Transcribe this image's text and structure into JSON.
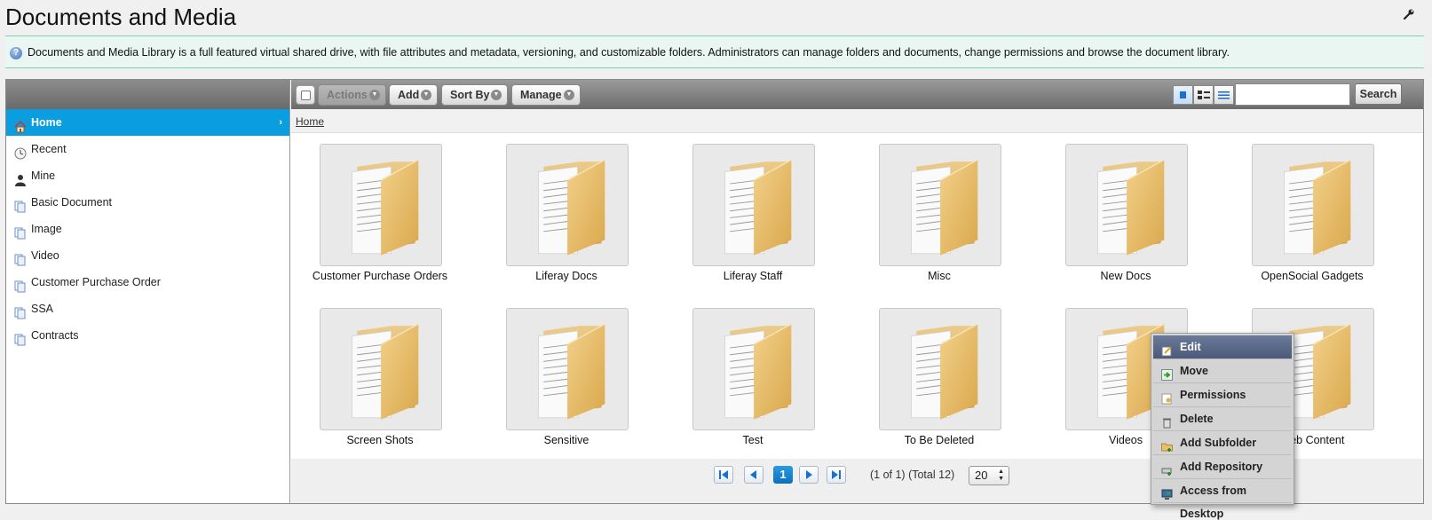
{
  "page": {
    "title": "Documents and Media",
    "description": "Documents and Media Library is a full featured virtual shared drive, with file attributes and metadata, versioning, and customizable folders. Administrators can manage folders and documents, change permissions and browse the document library."
  },
  "sidebar": {
    "items": [
      {
        "label": "Home",
        "icon": "home-icon",
        "active": true
      },
      {
        "label": "Recent",
        "icon": "clock-icon"
      },
      {
        "label": "Mine",
        "icon": "user-icon"
      },
      {
        "label": "Basic Document",
        "icon": "document-type-icon"
      },
      {
        "label": "Image",
        "icon": "document-type-icon"
      },
      {
        "label": "Video",
        "icon": "document-type-icon"
      },
      {
        "label": "Customer Purchase Order",
        "icon": "document-type-icon"
      },
      {
        "label": "SSA",
        "icon": "document-type-icon"
      },
      {
        "label": "Contracts",
        "icon": "document-type-icon"
      }
    ]
  },
  "toolbar": {
    "actions_label": "Actions",
    "add_label": "Add",
    "sort_by_label": "Sort By",
    "manage_label": "Manage",
    "search_label": "Search",
    "search_value": ""
  },
  "breadcrumb": {
    "home": "Home"
  },
  "folders": [
    {
      "name": "Customer Purchase Orders"
    },
    {
      "name": "Liferay Docs"
    },
    {
      "name": "Liferay Staff"
    },
    {
      "name": "Misc"
    },
    {
      "name": "New Docs"
    },
    {
      "name": "OpenSocial Gadgets"
    },
    {
      "name": "Screen Shots"
    },
    {
      "name": "Sensitive"
    },
    {
      "name": "Test"
    },
    {
      "name": "To Be Deleted"
    },
    {
      "name": "Videos"
    },
    {
      "name": "Web Content"
    }
  ],
  "pagination": {
    "current_page": "1",
    "info": "(1 of 1) (Total 12)",
    "page_size": "20"
  },
  "context_menu": {
    "items": [
      {
        "label": "Edit",
        "icon": "edit-icon"
      },
      {
        "label": "Move",
        "icon": "move-icon"
      },
      {
        "label": "Permissions",
        "icon": "permissions-icon"
      },
      {
        "label": "Delete",
        "icon": "trash-icon"
      },
      {
        "label": "Add Subfolder",
        "icon": "add-subfolder-icon"
      },
      {
        "label": "Add Repository",
        "icon": "add-repository-icon"
      },
      {
        "label": "Access from Desktop",
        "icon": "desktop-icon"
      }
    ]
  },
  "colors": {
    "accent": "#0a9ee0",
    "info_border": "#7fcfb0",
    "folder": "#e0b45e"
  }
}
